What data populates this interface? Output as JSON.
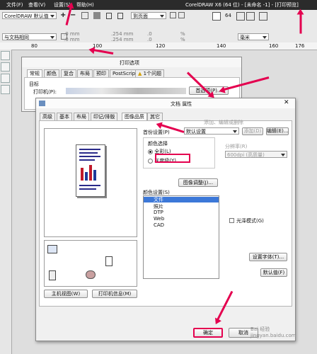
{
  "app": {
    "menu": [
      "文件(F)",
      "查看(V)",
      "设置(S)",
      "帮助(H)"
    ],
    "title": "CorelDRAW X6 (64 位) - [未命名 -1] - [打印预览]"
  },
  "toolbar1": {
    "preset_combo": "CorelDRAW 默认值",
    "plus": "+",
    "minus": "−",
    "page_combo": "到页面",
    "size_top": ".0 mm",
    "size_bottom": ".0 mm",
    "offset_top": ".254 mm",
    "offset_bottom": ".254 mm",
    "pct_top": ".0",
    "pct_bottom": ".0",
    "percent": "%",
    "unit_combo": "毫米",
    "num64": "64"
  },
  "toolbar2": {
    "position_combo": "与文档相同"
  },
  "ruler": {
    "labels": [
      "80",
      "100",
      "120",
      "140",
      "160",
      "176"
    ]
  },
  "print_options": {
    "title": "打印选项",
    "tabs": [
      "常规",
      "颜色",
      "复合",
      "布局",
      "预印",
      "PostScript",
      "1个问题"
    ],
    "target_label": "目标",
    "printer_label": "打印机(P):",
    "preferences_button": "首选项(P)..."
  },
  "doc_props": {
    "title": "文档 属性",
    "tabs": [
      "高级",
      "基本",
      "布局",
      "印记/排版",
      "图像品质",
      "其它"
    ],
    "preset_label": "首份设置(P)",
    "preset_value": "默认设置",
    "add_button": "添加(D)",
    "edit_button": "编辑(E)...",
    "faded_hint": "添加、编辑或删除",
    "color_mode_label": "颜色选择",
    "color_option": "全彩(L)",
    "gray_option": "灰度级(Y)",
    "resolution_label": "分辨率(R)",
    "resolution_value": "600dpi (高质量)",
    "image_adjust_button": "图像调整(J)...",
    "color_settings_label": "颜色设置(S)",
    "color_settings_items": [
      "文件",
      "照片",
      "DTP",
      "Web",
      "CAD"
    ],
    "gloss_label": "光泽模式(G)",
    "font_settings_button": "设置字体(T)...",
    "defaults_button": "默认值(F)",
    "host_view_button": "主机视图(W)",
    "printer_info_button": "打印机信息(M)",
    "ok_button": "确定",
    "cancel_button": "取消"
  },
  "watermark": "Bai 经验 jingyan.baidu.com",
  "colors": {
    "accent": "#e4004f",
    "selection": "#3c78d8",
    "titlebar": "#2b2b2b"
  }
}
